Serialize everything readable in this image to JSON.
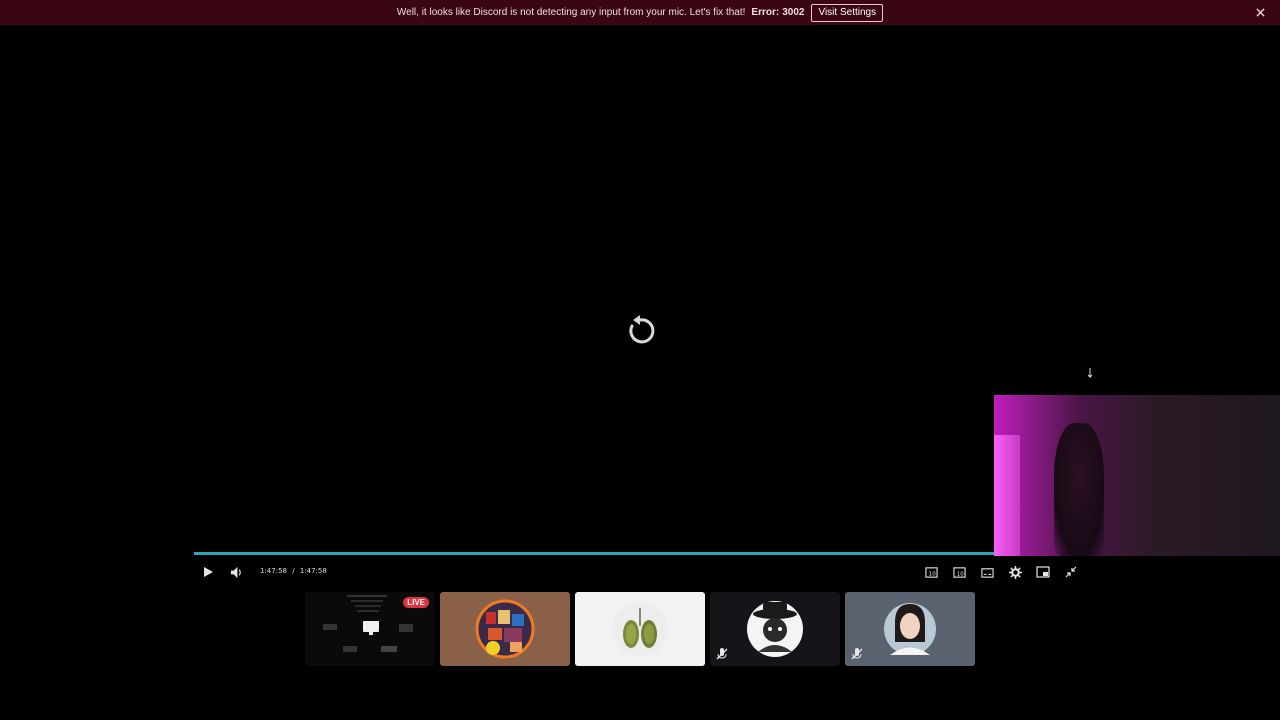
{
  "banner": {
    "message": "Well, it looks like Discord is not detecting any input from your mic. Let's fix that!",
    "error_label": "Error:",
    "error_code": "3002",
    "button_label": "Visit Settings",
    "close_icon": "close-icon",
    "background_color": "#3a0611"
  },
  "player": {
    "center_icon": "replay-icon",
    "progress_percent": 100,
    "progress_color": "#2aa7b8",
    "time_current": "1:47:58",
    "time_separator": "/",
    "time_total": "1:47:58",
    "left_controls": [
      "play-icon",
      "volume-icon"
    ],
    "right_controls": [
      "rewind-10-icon",
      "forward-10-icon",
      "captions-icon",
      "gear-icon",
      "picture-in-picture-icon",
      "collapse-icon"
    ]
  },
  "participants": {
    "tiles": [
      {
        "name": "stream-preview",
        "badge": "LIVE",
        "muted": false,
        "background": "#0a0a0a"
      },
      {
        "name": "avatar-anime-collage",
        "badge": "",
        "muted": false,
        "background": "#8a6048"
      },
      {
        "name": "avatar-lungs",
        "badge": "",
        "muted": false,
        "background": "#f2f2f2"
      },
      {
        "name": "avatar-hat-character",
        "badge": "",
        "muted": true,
        "background": "#151418"
      },
      {
        "name": "avatar-woman-portrait",
        "badge": "",
        "muted": true,
        "background": "#5a6270"
      }
    ],
    "badge_color": "#e0323c"
  }
}
